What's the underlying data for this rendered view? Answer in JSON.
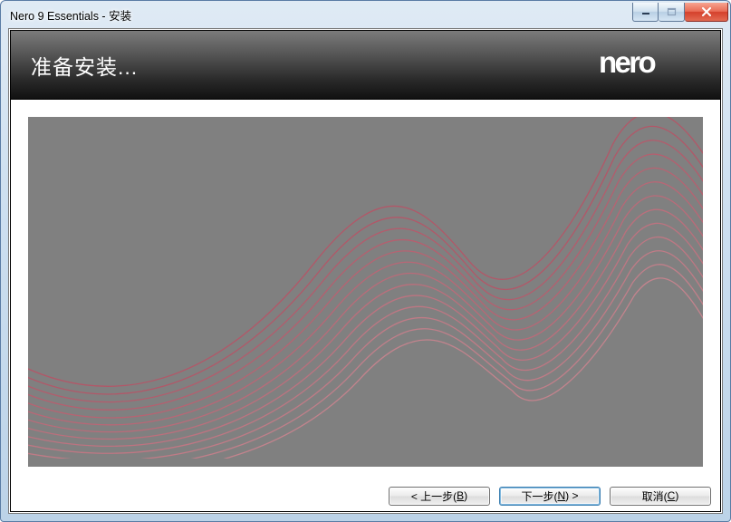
{
  "window": {
    "title": "Nero 9 Essentials - 安装"
  },
  "banner": {
    "title": "准备安装...",
    "logo_text": "nero"
  },
  "buttons": {
    "back": {
      "prefix": "< 上一步(",
      "hotkey": "B",
      "suffix": ")"
    },
    "next": {
      "prefix": "下一步(",
      "hotkey": "N",
      "suffix": ") >"
    },
    "cancel": {
      "prefix": "取消(",
      "hotkey": "C",
      "suffix": ")"
    }
  }
}
